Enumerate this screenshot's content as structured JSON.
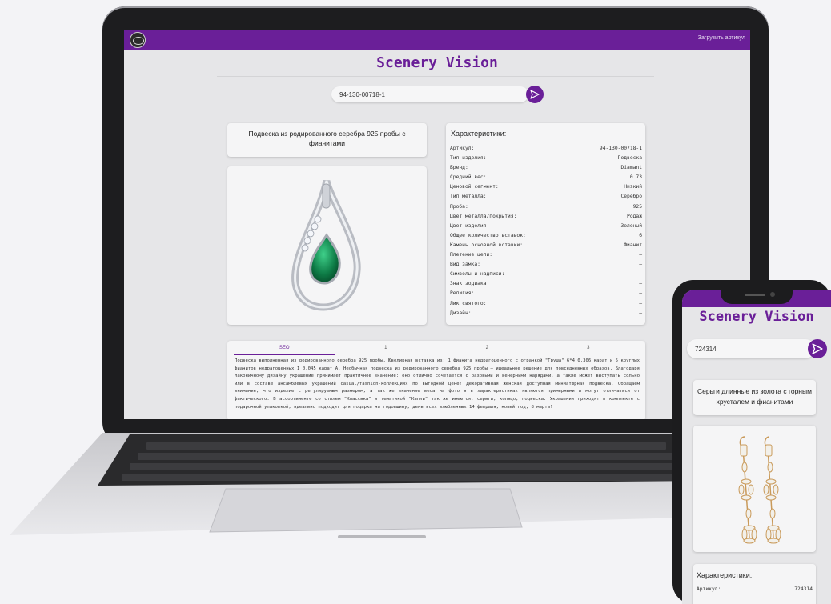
{
  "app": {
    "title": "Scenery Vision",
    "upload_label": "Загрузить артикул",
    "colors": {
      "accent": "#6a1f98",
      "background": "#e6e6e8"
    }
  },
  "laptop": {
    "search_value": "94-130-00718-1",
    "product_title": "Подвеска из родированного серебра 925 пробы с фианитами",
    "characteristics_heading": "Характеристики:",
    "characteristics": [
      {
        "label": "Артикул:",
        "value": "94-130-00718-1"
      },
      {
        "label": "Тип изделия:",
        "value": "Подвеска"
      },
      {
        "label": "Бренд:",
        "value": "Diamant"
      },
      {
        "label": "Средний вес:",
        "value": "0.73"
      },
      {
        "label": "Ценовой сегмент:",
        "value": "Низкий"
      },
      {
        "label": "Тип металла:",
        "value": "Серебро"
      },
      {
        "label": "Проба:",
        "value": "925"
      },
      {
        "label": "Цвет металла/покрытия:",
        "value": "Родаж"
      },
      {
        "label": "Цвет изделия:",
        "value": "Зеленый"
      },
      {
        "label": "Общее количество вставок:",
        "value": "6"
      },
      {
        "label": "Камень основной вставки:",
        "value": "Фианит"
      },
      {
        "label": "Плетение цепи:",
        "value": "–"
      },
      {
        "label": "Вид замка:",
        "value": "–"
      },
      {
        "label": "Символы и надписи:",
        "value": "–"
      },
      {
        "label": "Знак зодиака:",
        "value": "–"
      },
      {
        "label": "Религия:",
        "value": "–"
      },
      {
        "label": "Лик святого:",
        "value": "–"
      },
      {
        "label": "Дизайн:",
        "value": "–"
      }
    ],
    "tabs": [
      "SEO",
      "1",
      "2",
      "3"
    ],
    "seo_text": "Подвеска выполненная из родированного серебра 925 пробы. Ювелирная вставка из: 1 фианита недрагоценного с огранкой \"Груша\" 6*4 0.306 карат и 5 круглых фианитов недрагоценных 1 0.045 карат А. Необычная подвеска из родированного серебра 925 пробы – идеальное решение для повседневных образов. Благодаря лаконичному дизайну украшение принимает практичное значение: оно отлично сочетается с базовыми и вечерними нарядами, а также может выступать сольно или в составе ансамблевых украшений casual/fashion-коллекциях по выгодной цене! Декоративная женская доступная миниатюрная подвеска. Обращаем внимание, что изделие с регулируемым размером, а так же значение веса на фото и в характеристиках являются примерными и могут отличаться от фактического. В ассортименте со стилем \"Классика\" и тематикой \"Капли\" так же имеются: серьги, кольцо, подвеска. Украшения приходят в комплекте с подарочной упаковкой, идеально подходят для подарка на годовщину, день всех влюбленных 14 февраля, новый год, 8 марта!"
  },
  "phone": {
    "search_value": "724314",
    "product_title": "Серьги длинные из золота с горным хрусталем и фианитами",
    "characteristics_heading": "Характеристики:",
    "first_row": {
      "label": "Артикул:",
      "value": "724314"
    }
  }
}
